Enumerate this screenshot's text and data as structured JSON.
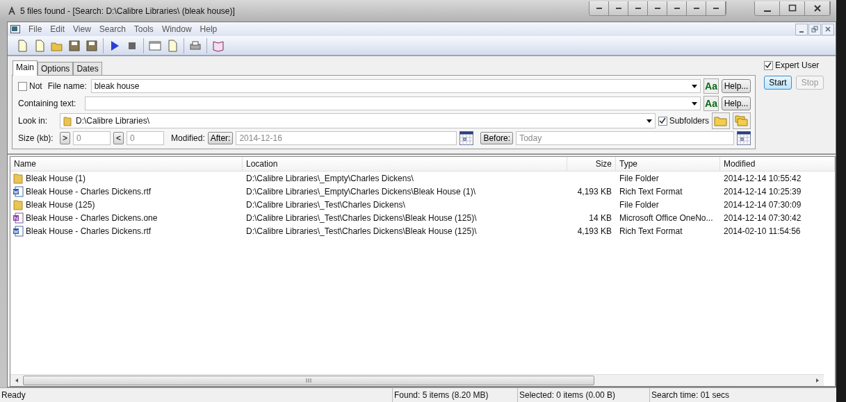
{
  "window": {
    "title": "5 files found - [Search: D:\\Calibre Libraries\\ (bleak house)]"
  },
  "menu": [
    "File",
    "Edit",
    "View",
    "Search",
    "Tools",
    "Window",
    "Help"
  ],
  "tabs": [
    {
      "label": "Main",
      "selected": true
    },
    {
      "label": "Options",
      "selected": false
    },
    {
      "label": "Dates",
      "selected": false
    }
  ],
  "form": {
    "not": {
      "label": "Not",
      "checked": false
    },
    "file_name": {
      "label": "File name:",
      "value": "bleak house",
      "case_button": "Aa",
      "help_button": "Help..."
    },
    "containing_text": {
      "label": "Containing text:",
      "case_button": "Aa",
      "help_button": "Help..."
    },
    "look_in": {
      "label": "Look in:",
      "value": "D:\\Calibre Libraries\\"
    },
    "subfolders": {
      "label": "Subfolders",
      "checked": true
    },
    "size": {
      "label": "Size (kb):",
      "greater_button": ">",
      "greater_value": "0",
      "less_button": "<",
      "less_value": "0"
    },
    "modified": {
      "label": "Modified:",
      "after_button": "After:",
      "after_value": "2014-12-16",
      "before_button": "Before:",
      "before_placeholder": "Today"
    }
  },
  "expert_user": {
    "label": "Expert User",
    "checked": true
  },
  "buttons": [
    {
      "label": "Start",
      "disabled": false
    },
    {
      "label": "Stop",
      "disabled": true
    }
  ],
  "table": {
    "columns": [
      "Name",
      "Location",
      "Size",
      "Type",
      "Modified"
    ],
    "rows": [
      {
        "kind": "folder",
        "name": "Bleak House (1)",
        "location": "D:\\Calibre Libraries\\_Empty\\Charles Dickens\\",
        "size": "",
        "type": "File Folder",
        "modified": "2014-12-14 10:55:42"
      },
      {
        "kind": "word",
        "name": "Bleak House - Charles Dickens.rtf",
        "location": "D:\\Calibre Libraries\\_Empty\\Charles Dickens\\Bleak House (1)\\",
        "size": "4,193 KB",
        "type": "Rich Text Format",
        "modified": "2014-12-14 10:25:39"
      },
      {
        "kind": "folder",
        "name": "Bleak House (125)",
        "location": "D:\\Calibre Libraries\\_Test\\Charles Dickens\\",
        "size": "",
        "type": "File Folder",
        "modified": "2014-12-14 07:30:09"
      },
      {
        "kind": "onenote",
        "name": "Bleak House - Charles Dickens.one",
        "location": "D:\\Calibre Libraries\\_Test\\Charles Dickens\\Bleak House (125)\\",
        "size": "14 KB",
        "type": "Microsoft Office OneNo...",
        "modified": "2014-12-14 07:30:42"
      },
      {
        "kind": "word",
        "name": "Bleak House - Charles Dickens.rtf",
        "location": "D:\\Calibre Libraries\\_Test\\Charles Dickens\\Bleak House (125)\\",
        "size": "4,193 KB",
        "type": "Rich Text Format",
        "modified": "2014-02-10 11:54:56"
      }
    ]
  },
  "status_bar": {
    "state": "Ready",
    "found": "Found: 5 items (8.20 MB)",
    "selected": "Selected: 0 items (0.00 B)",
    "search_time": "Search time: 01 secs"
  }
}
